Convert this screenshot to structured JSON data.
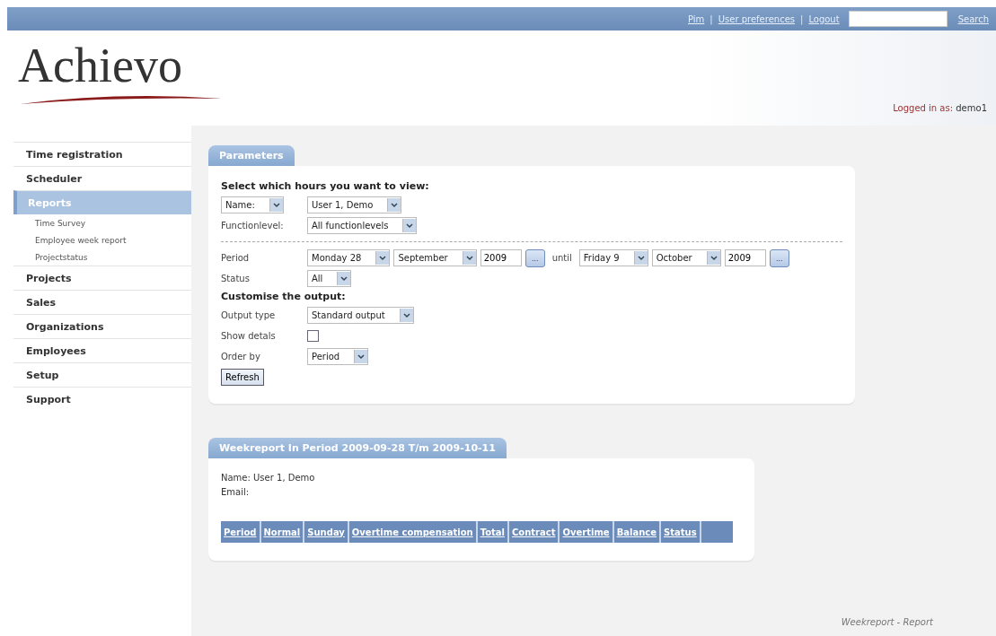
{
  "top_bar": {
    "links": [
      "Pim",
      "User preferences",
      "Logout"
    ],
    "separator": "|",
    "search_button": "Search"
  },
  "header": {
    "logo": "Achievo",
    "logged_in_label": "Logged in as:",
    "logged_in_user": "demo1"
  },
  "sidebar": {
    "items": [
      {
        "label": "Time registration",
        "selected": false
      },
      {
        "label": "Scheduler",
        "selected": false
      },
      {
        "label": "Reports",
        "selected": true,
        "children": [
          {
            "label": "Time Survey"
          },
          {
            "label": "Employee week report"
          },
          {
            "label": "Projectstatus"
          }
        ]
      },
      {
        "label": "Projects",
        "selected": false
      },
      {
        "label": "Sales",
        "selected": false
      },
      {
        "label": "Organizations",
        "selected": false
      },
      {
        "label": "Employees",
        "selected": false
      },
      {
        "label": "Setup",
        "selected": false
      },
      {
        "label": "Support",
        "selected": false
      }
    ]
  },
  "parameters": {
    "title": "Parameters",
    "rows": [
      {
        "kind": "heading",
        "text": "Select which hours you want to view:"
      },
      {
        "kind": "select_row",
        "lead_select": "Name:",
        "selects": [
          "User 1, Demo"
        ]
      },
      {
        "kind": "select_row",
        "label": "Functionlevel:",
        "selects": [
          "All functionlevels"
        ]
      },
      {
        "kind": "divider"
      },
      {
        "kind": "period",
        "label": "Period",
        "from": {
          "day": "Monday 28",
          "month": "September",
          "year": "2009",
          "picker": "..."
        },
        "until": "until",
        "to": {
          "day": "Friday 9",
          "month": "October",
          "year": "2009",
          "picker": "..."
        }
      },
      {
        "kind": "select_row",
        "label": "Status",
        "selects": [
          "All"
        ]
      },
      {
        "kind": "heading",
        "text": "Customise the output:"
      },
      {
        "kind": "select_row",
        "label": "Output type",
        "selects": [
          "Standard output"
        ]
      },
      {
        "kind": "checkbox",
        "label": "Show detals",
        "checked": false
      },
      {
        "kind": "select_row",
        "label": "Order by",
        "selects": [
          "Period"
        ]
      },
      {
        "kind": "button",
        "text": "Refresh"
      }
    ]
  },
  "weekreport": {
    "title": "Weekreport In Period 2009-09-28 T/m 2009-10-11",
    "lines": [
      "Name: User 1, Demo",
      "Email:"
    ],
    "columns": [
      "Period",
      "Normal",
      "Sunday",
      "Overtime compensation",
      "Total",
      "Contract",
      "Overtime",
      "Balance",
      "Status"
    ]
  },
  "footer": "Weekreport - Report"
}
